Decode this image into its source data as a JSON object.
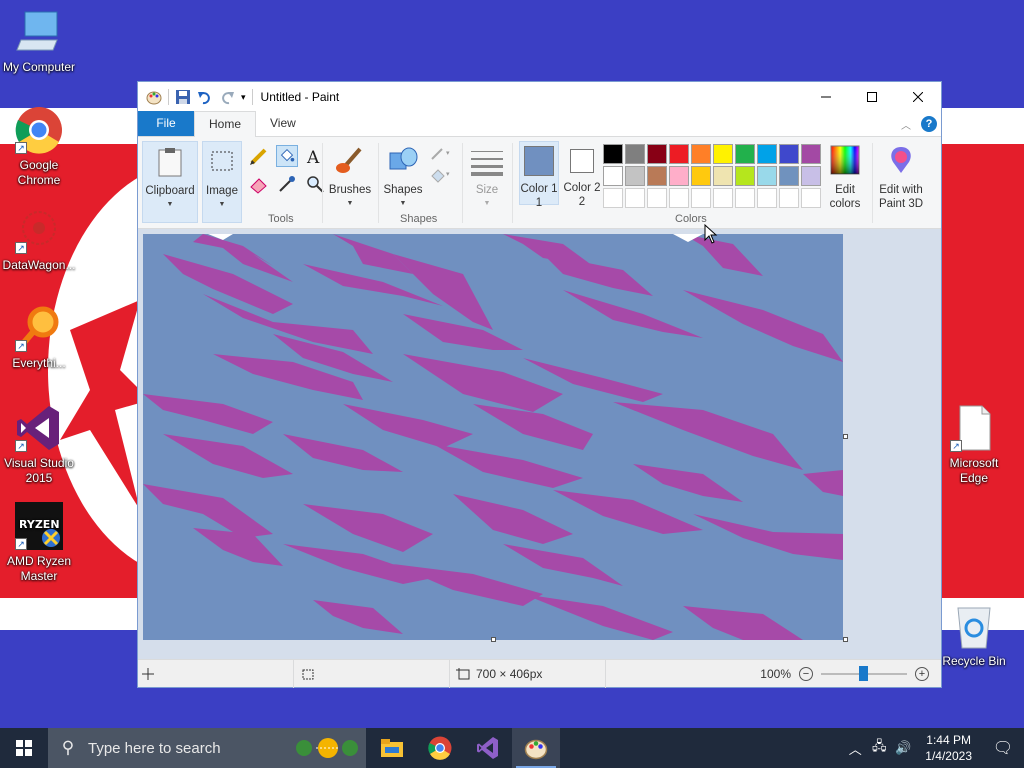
{
  "desktop": {
    "icons": [
      {
        "label": "My Computer",
        "icon": "computer-icon"
      },
      {
        "label": "Google Chrome",
        "icon": "chrome-icon"
      },
      {
        "label": "DataWagon...",
        "icon": "datawagon-icon"
      },
      {
        "label": "Everythi...",
        "icon": "everything-search-icon"
      },
      {
        "label": "Visual Studio 2015",
        "icon": "visual-studio-icon"
      },
      {
        "label": "AMD Ryzen Master",
        "icon": "ryzen-master-icon"
      },
      {
        "label": "Microsoft Edge",
        "icon": "edge-file-icon"
      },
      {
        "label": "Recycle Bin",
        "icon": "recycle-bin-icon"
      }
    ]
  },
  "window": {
    "title": "Untitled - Paint",
    "tabs": {
      "file": "File",
      "home": "Home",
      "view": "View"
    },
    "ribbon": {
      "clipboard": "Clipboard",
      "image": "Image",
      "tools_group": "Tools",
      "brushes": "Brushes",
      "shapes": "Shapes",
      "shapes_group": "Shapes",
      "size": "Size",
      "color1": "Color 1",
      "color1_num": "1",
      "color2": "Color 2",
      "color2_num": "2",
      "colors_group": "Colors",
      "edit_colors_1": "Edit",
      "edit_colors_2": "colors",
      "edit_paint3d_1": "Edit with",
      "edit_paint3d_2": "Paint 3D"
    },
    "colors": {
      "color1": "#7090c0",
      "color2": "#ffffff",
      "row1": [
        "#000000",
        "#7f7f7f",
        "#880015",
        "#ed1c24",
        "#ff7f27",
        "#fff200",
        "#22b14c",
        "#00a2e8",
        "#3f48cc",
        "#a349a4"
      ],
      "row2": [
        "#ffffff",
        "#c3c3c3",
        "#b97a57",
        "#ffaec9",
        "#ffc90e",
        "#efe4b0",
        "#b5e61d",
        "#99d9ea",
        "#7092be",
        "#c8bfe7"
      ]
    },
    "canvas": {
      "background": "#7090c0",
      "pattern_color": "#a64aa8"
    },
    "status": {
      "dimensions": "700 × 406px",
      "zoom": "100%"
    }
  },
  "taskbar": {
    "search_placeholder": "Type here to search",
    "time": "1:44 PM",
    "date": "1/4/2023"
  }
}
